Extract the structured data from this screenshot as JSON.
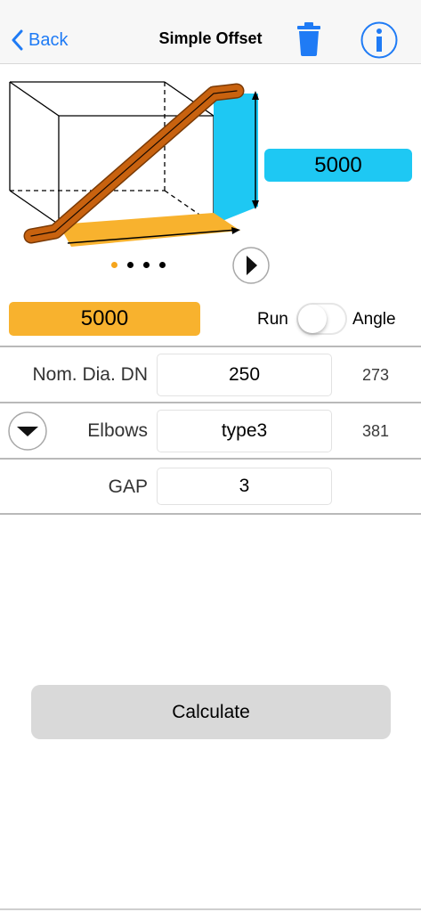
{
  "nav": {
    "back_label": "Back",
    "title": "Simple Offset",
    "delete_icon": "trash-icon",
    "info_icon": "info-icon"
  },
  "diagram": {
    "rise_value": "5000",
    "pager": {
      "total": 4,
      "active": 1
    },
    "colors": {
      "pipe": "#c8620f",
      "rise": "#1ec8f3",
      "run": "#f8b22e"
    }
  },
  "run": {
    "value": "5000",
    "toggle_left_label": "Run",
    "toggle_right_label": "Angle",
    "toggle_on": false
  },
  "rows": [
    {
      "label": "Nom. Dia. DN",
      "value": "250",
      "extra": "273"
    },
    {
      "label": "Elbows",
      "value": "type3",
      "extra": "381"
    },
    {
      "label": "GAP",
      "value": "3",
      "extra": ""
    }
  ],
  "calculate_label": "Calculate"
}
